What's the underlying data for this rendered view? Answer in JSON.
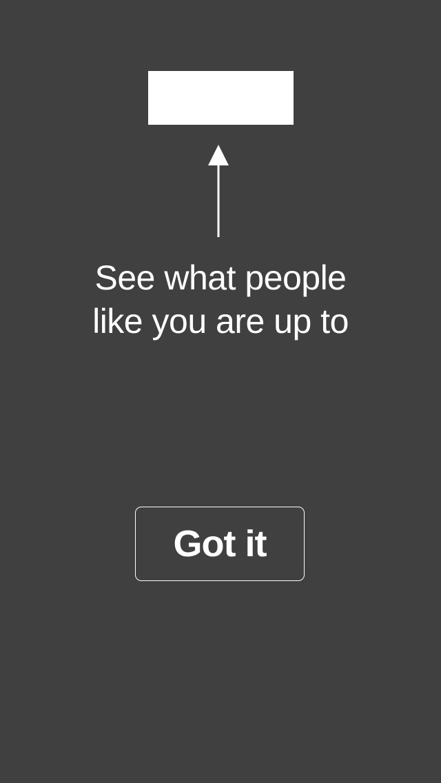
{
  "tooltip": {
    "message_line1": "See what people",
    "message_line2": "like you are up to"
  },
  "actions": {
    "got_it_label": "Got it"
  },
  "colors": {
    "background": "#404040",
    "foreground": "#ffffff"
  },
  "icons": {
    "pointer": "arrow-up-icon"
  }
}
